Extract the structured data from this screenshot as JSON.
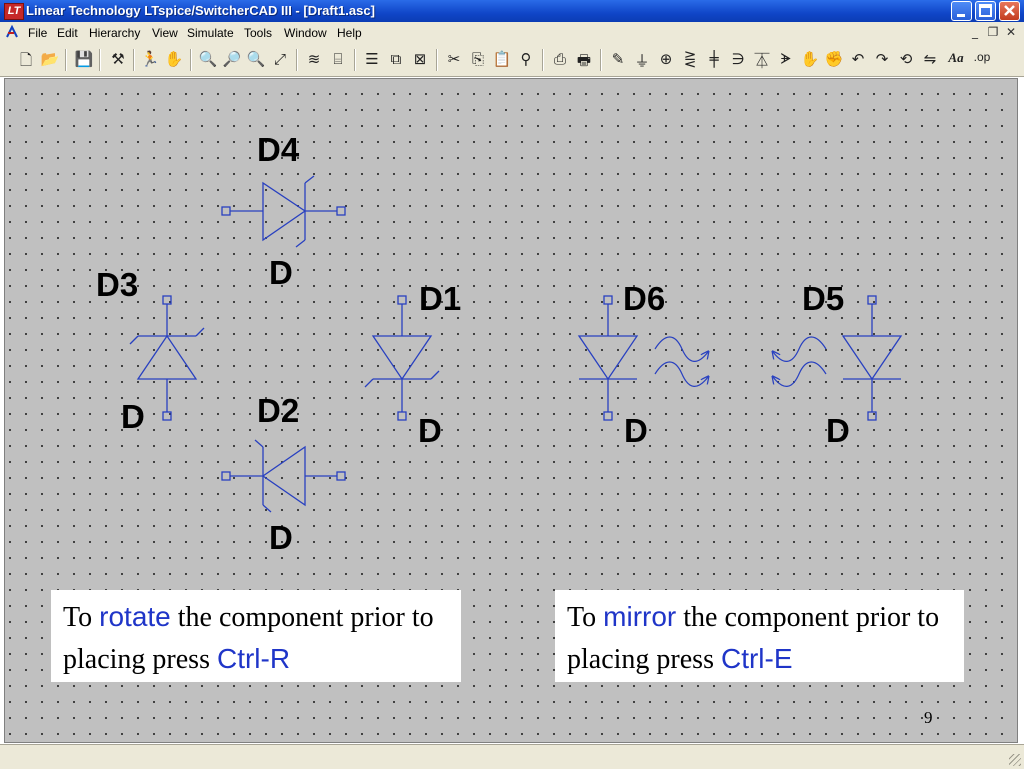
{
  "window": {
    "app_icon": "LT",
    "title": "Linear Technology LTspice/SwitcherCAD III - [Draft1.asc]"
  },
  "menu": [
    "File",
    "Edit",
    "Hierarchy",
    "View",
    "Simulate",
    "Tools",
    "Window",
    "Help"
  ],
  "toolbar_icons": [
    "new-schematic-icon",
    "open-icon",
    "save-icon",
    "control-panel-icon",
    "run-icon",
    "halt-icon",
    "zoom-in-icon",
    "pan-icon",
    "zoom-out-icon",
    "zoom-fit-icon",
    "waveform-icon",
    "autorange-icon",
    "tile-horizontal-icon",
    "cascade-icon",
    "close-windows-icon",
    "cut-icon",
    "copy-icon",
    "paste-icon",
    "find-icon",
    "print-preview-icon",
    "print-icon",
    "draw-wire-icon",
    "ground-icon",
    "label-net-icon",
    "resistor-icon",
    "capacitor-icon",
    "inductor-icon",
    "diode-icon",
    "component-icon",
    "move-icon",
    "drag-icon",
    "undo-icon",
    "redo-icon",
    "rotate-icon",
    "mirror-icon",
    "text-icon",
    "spice-directive-icon"
  ],
  "components": {
    "d4": {
      "ref": "D4",
      "value": "D"
    },
    "d3": {
      "ref": "D3",
      "value": "D"
    },
    "d2": {
      "ref": "D2",
      "value": "D"
    },
    "d1": {
      "ref": "D1",
      "value": "D"
    },
    "d6": {
      "ref": "D6",
      "value": "D"
    },
    "d5": {
      "ref": "D5",
      "value": "D"
    }
  },
  "notes": {
    "rotate": {
      "pre": "To ",
      "kw1": "rotate",
      "mid": " the component prior to placing press ",
      "kw2": "Ctrl-R"
    },
    "mirror": {
      "pre": "To ",
      "kw1": "mirror",
      "mid": " the component prior to placing press ",
      "kw2": "Ctrl-E"
    }
  },
  "page_number": "9",
  "colors": {
    "wire": "#2840c0",
    "keyword": "#1f35c8",
    "titlebar": "#1046c8",
    "canvas": "#c0c0c0"
  }
}
